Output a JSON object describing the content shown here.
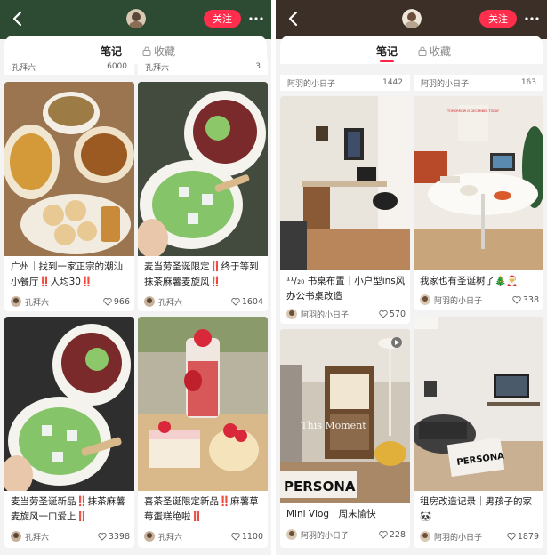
{
  "header": {
    "follow_label": "关注"
  },
  "tabs": {
    "notes": "笔记",
    "favorites": "收藏"
  },
  "left_panel": {
    "top_strip": [
      {
        "author": "孔拜六",
        "likes": "6000"
      },
      {
        "author": "孔拜六",
        "likes": "3"
      }
    ],
    "cards": [
      {
        "title": "广州｜找到一家正宗的潮汕小餐厅‼️人均30‼️",
        "author": "孔拜六",
        "likes": "966"
      },
      {
        "title": "麦当劳圣诞限定‼️终于等到抹茶麻薯麦旋风‼️",
        "author": "孔拜六",
        "likes": "1604"
      },
      {
        "title": "麦当劳圣诞新品‼️抹茶麻薯麦旋风一口爱上‼️",
        "author": "孔拜六",
        "likes": "3398"
      },
      {
        "title": "喜茶圣诞限定新品‼️麻薯草莓蛋糕绝啦‼️",
        "author": "孔拜六",
        "likes": "1100"
      }
    ]
  },
  "right_panel": {
    "top_strip": [
      {
        "author": "阿羽的小日子",
        "likes": "1442"
      },
      {
        "author": "阿羽的小日子",
        "likes": "163"
      }
    ],
    "cards": [
      {
        "title": "¹¹/₂₀ 书桌布置｜小户型ins风办公书桌改造",
        "author": "阿羽的小日子",
        "likes": "570"
      },
      {
        "title": "我家也有圣诞树了🎄🎅",
        "author": "阿羽的小日子",
        "likes": "338"
      },
      {
        "title": "Mini Vlog｜周末愉快",
        "author": "阿羽的小日子",
        "likes": "228"
      },
      {
        "title": "租房改造记录｜男孩子的家🐼",
        "author": "阿羽的小日子",
        "likes": "1879"
      }
    ],
    "overlay_texts": {
      "calendar": "TOMORROW IS DECEMBER TODAY",
      "moment": "This Moment",
      "persona": "PERSONA"
    }
  },
  "colors": {
    "accent": "#ff2e4d",
    "left_header": "#2d4a33",
    "right_header": "#3b2f28"
  },
  "icons": [
    "back-icon",
    "avatar",
    "more-icon",
    "heart-icon",
    "lock-icon",
    "play-icon"
  ]
}
